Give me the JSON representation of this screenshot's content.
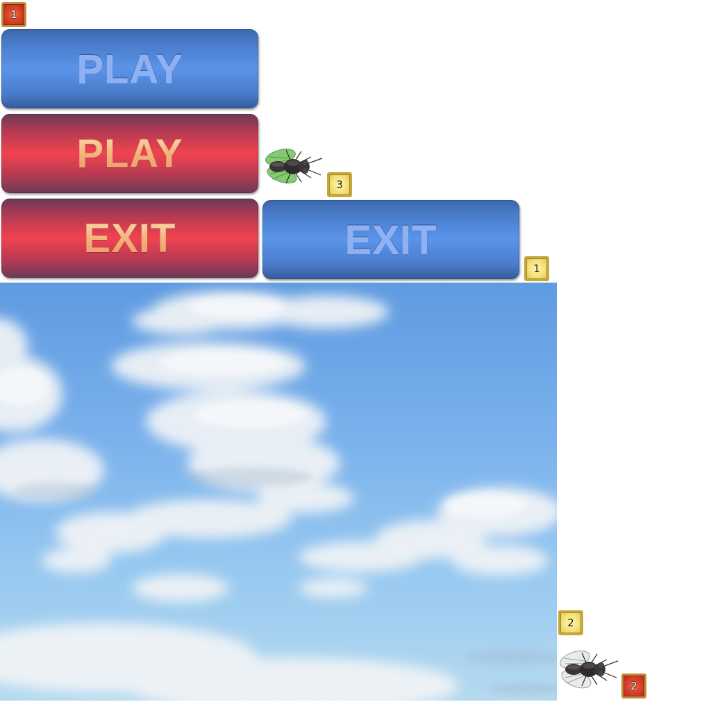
{
  "buttons": {
    "play_normal": {
      "label": "PLAY",
      "style": "blue"
    },
    "play_active": {
      "label": "PLAY",
      "style": "red"
    },
    "exit_active": {
      "label": "EXIT",
      "style": "red"
    },
    "exit_normal": {
      "label": "EXIT",
      "style": "blue"
    }
  },
  "badges": {
    "red_1": {
      "label": "1",
      "style": "red"
    },
    "yellow_3": {
      "label": "3",
      "style": "yellow"
    },
    "yellow_1": {
      "label": "1",
      "style": "yellow"
    },
    "yellow_2": {
      "label": "2",
      "style": "yellow"
    },
    "red_2": {
      "label": "2",
      "style": "red"
    }
  },
  "sprites": {
    "background": "sky-with-clouds",
    "fly_green": "green-winged-fly",
    "fly_grey": "grey-winged-fly"
  },
  "colors": {
    "button_blue": "#5a94ea",
    "button_red": "#f2434f",
    "badge_red": "#e0452c",
    "badge_yellow": "#f4e27a",
    "sky_top": "#5f9be0",
    "sky_bottom": "#b5daf0"
  }
}
